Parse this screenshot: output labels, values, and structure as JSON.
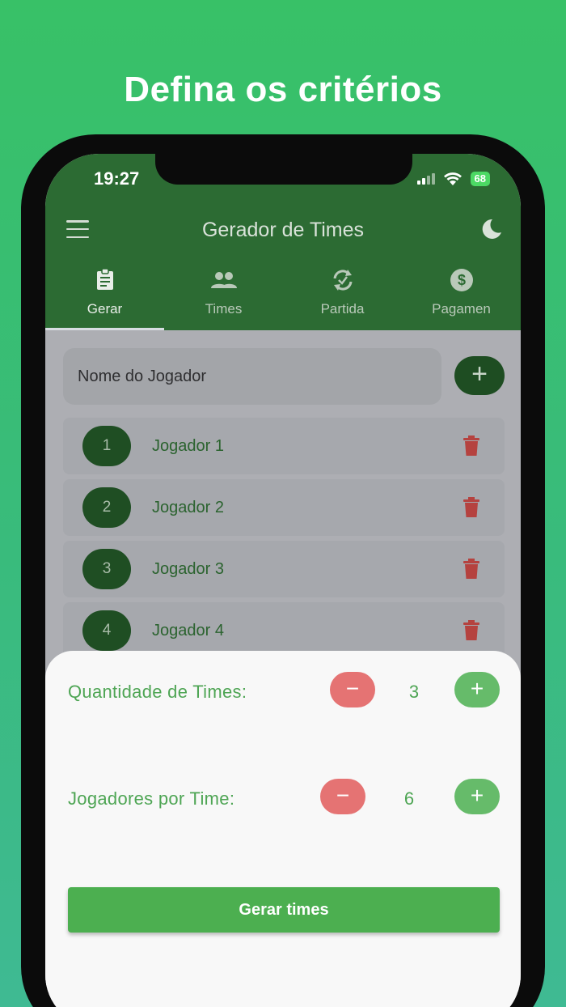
{
  "headline": "Defina os critérios",
  "status_bar": {
    "time": "19:27",
    "battery": "68"
  },
  "app_bar": {
    "title": "Gerador de Times"
  },
  "tabs": [
    {
      "label": "Gerar",
      "icon": "clipboard-icon",
      "active": true
    },
    {
      "label": "Times",
      "icon": "group-icon",
      "active": false
    },
    {
      "label": "Partida",
      "icon": "sync-icon",
      "active": false
    },
    {
      "label": "Pagamen",
      "icon": "dollar-icon",
      "active": false
    }
  ],
  "player_input": {
    "placeholder": "Nome do Jogador",
    "add_label": "+"
  },
  "players": [
    {
      "number": "1",
      "name": "Jogador 1"
    },
    {
      "number": "2",
      "name": "Jogador 2"
    },
    {
      "number": "3",
      "name": "Jogador 3"
    },
    {
      "number": "4",
      "name": "Jogador 4"
    }
  ],
  "criteria": {
    "teams_label": "Quantidade de Times:",
    "teams_count": "3",
    "players_label": "Jogadores por Time:",
    "players_count": "6",
    "minus": "−",
    "plus": "+"
  },
  "generate_button": "Gerar times",
  "colors": {
    "background_top": "#38c167",
    "app_bar": "#2c6b33",
    "accent_green": "#4caf50",
    "minus_red": "#e57373",
    "plus_green": "#66bb6a",
    "delete_red": "#b5423f"
  }
}
